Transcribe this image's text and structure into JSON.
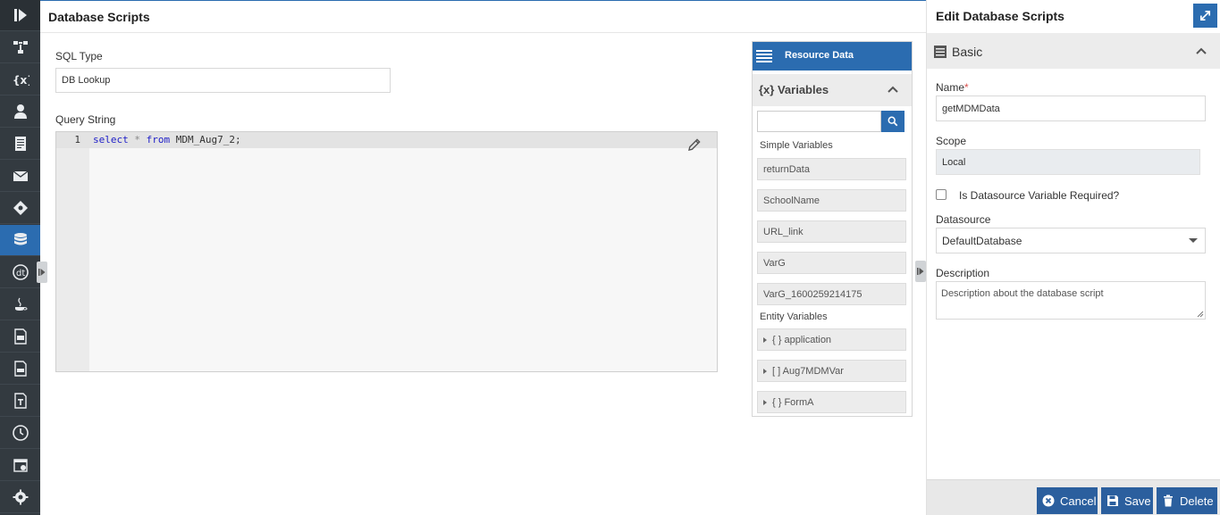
{
  "main": {
    "title": "Database Scripts",
    "sql_type_label": "SQL Type",
    "sql_type_value": "DB Lookup",
    "query_label": "Query String",
    "line_number": "1",
    "code": {
      "kw1": "select",
      "op": "*",
      "kw2": "from",
      "rest": "MDM_Aug7_2;"
    }
  },
  "resource": {
    "header": "Resource Data",
    "variables_title": "{x} Variables",
    "simple_label": "Simple Variables",
    "simple_items": [
      "returnData",
      "SchoolName",
      "URL_link",
      "VarG",
      "VarG_1600259214175"
    ],
    "entity_label": "Entity Variables",
    "entity_items": [
      "{ } application",
      "[ ] Aug7MDMVar",
      "{ } FormA"
    ]
  },
  "right": {
    "title": "Edit Database Scripts",
    "section": "Basic",
    "name_label": "Name",
    "name_required": "*",
    "name_value": "getMDMData",
    "scope_label": "Scope",
    "scope_value": "Local",
    "ds_required_label": "Is Datasource Variable Required?",
    "datasource_label": "Datasource",
    "datasource_value": "DefaultDatabase",
    "description_label": "Description",
    "description_value": "Description about the database script",
    "cancel": "Cancel",
    "save": "Save",
    "delete": "Delete"
  },
  "colors": {
    "accent": "#2b6cb0",
    "nav_bg": "#333a40",
    "button": "#2b5f9e"
  }
}
